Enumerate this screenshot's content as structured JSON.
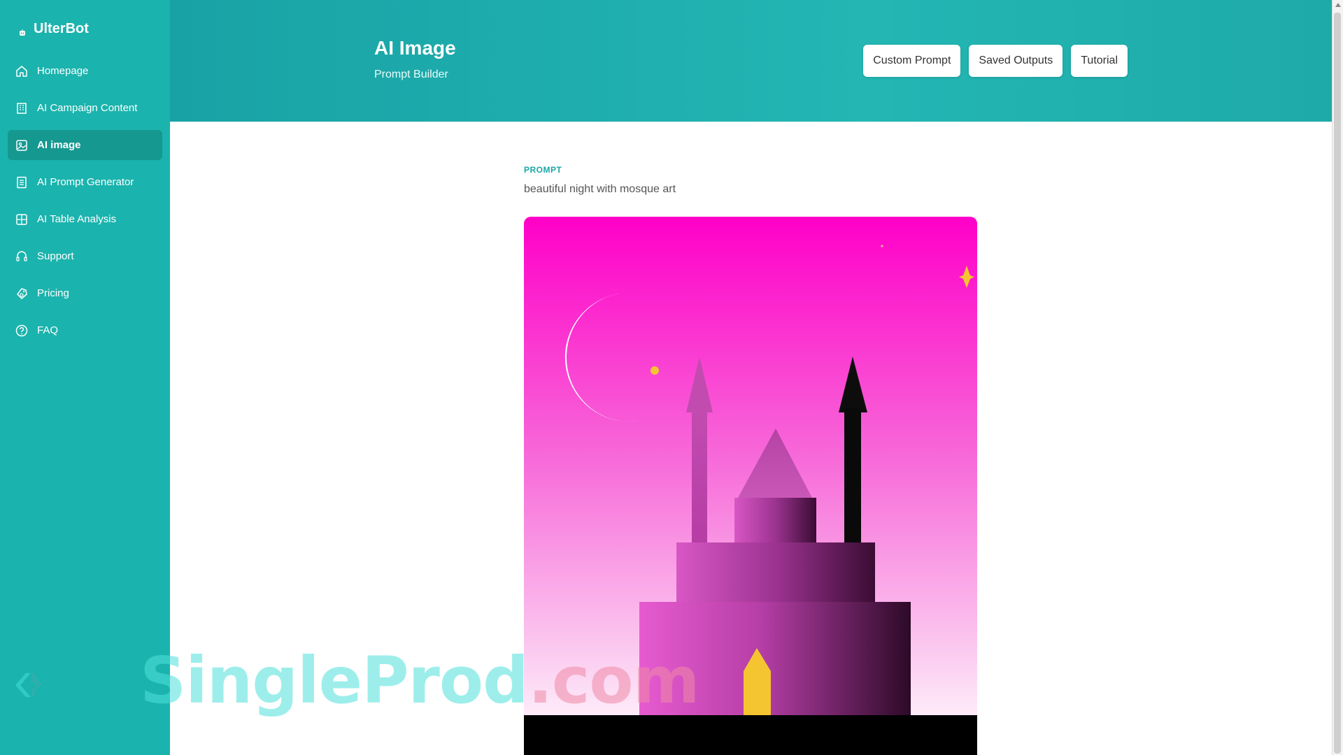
{
  "app": {
    "brand": "UlterBot"
  },
  "sidebar": {
    "items": [
      {
        "label": "Homepage",
        "icon": "home-icon",
        "active": false
      },
      {
        "label": "AI Campaign Content",
        "icon": "building-icon",
        "active": false
      },
      {
        "label": "AI image",
        "icon": "image-icon",
        "active": true
      },
      {
        "label": "AI Prompt Generator",
        "icon": "document-icon",
        "active": false
      },
      {
        "label": "AI Table Analysis",
        "icon": "table-icon",
        "active": false
      },
      {
        "label": "Support",
        "icon": "headset-icon",
        "active": false
      },
      {
        "label": "Pricing",
        "icon": "price-tag-icon",
        "active": false
      },
      {
        "label": "FAQ",
        "icon": "question-icon",
        "active": false
      }
    ]
  },
  "header": {
    "title": "AI Image",
    "subtitle": "Prompt Builder",
    "actions": [
      "Custom Prompt",
      "Saved Outputs",
      "Tutorial"
    ]
  },
  "main": {
    "prompt_label": "PROMPT",
    "prompt_text": "beautiful night with mosque art"
  },
  "watermark": {
    "part1": "SingleProd",
    "part2": ".com"
  },
  "colors": {
    "sidebar": "#1bb3ad",
    "sidebar_active": "#159890",
    "header": "#1eaaa8",
    "accent": "#1aa7a5",
    "sky_top": "#ff00c8",
    "sky_bottom": "#ffffff",
    "door": "#f5c531"
  }
}
